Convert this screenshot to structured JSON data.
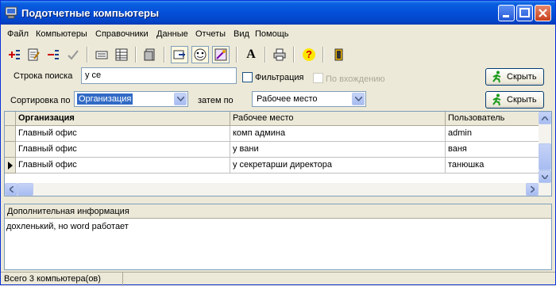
{
  "window": {
    "title": "Подотчетные компьютеры"
  },
  "menu": [
    "Файл",
    "Компьютеры",
    "Справочники",
    "Данные",
    "Отчеты",
    "Вид",
    "Помощь"
  ],
  "toolbar": {
    "icons": [
      "add-icon",
      "edit-icon",
      "delete-icon",
      "confirm-icon",
      "card-icon",
      "columns-icon",
      "print-preview-icon",
      "pin-icon",
      "face-icon",
      "magic-icon",
      "font-icon",
      "printer-icon",
      "help-icon",
      "exit-icon"
    ],
    "font_glyph": "A",
    "help_glyph": "?"
  },
  "search": {
    "label": "Строка поиска",
    "value": "у се",
    "filter_label": "Фильтрация",
    "filter_checked": false,
    "entry_label": "По вхождению",
    "entry_enabled": false,
    "hide_label": "Скрыть"
  },
  "sort": {
    "label": "Сортировка по",
    "primary": "Организация",
    "then_label": "затем по",
    "secondary": "Рабочее место",
    "hide_label": "Скрыть"
  },
  "grid": {
    "columns": [
      "Организация",
      "Рабочее место",
      "Пользователь"
    ],
    "rows": [
      [
        "Главный офис",
        "комп админа",
        "admin"
      ],
      [
        "Главный офис",
        "у вани",
        "ваня"
      ],
      [
        "Главный офис",
        "у секретарши директора",
        "танюшка"
      ]
    ],
    "current_row": 2
  },
  "info": {
    "title": "Дополнительная информация",
    "text": "дохленький, но word работает"
  },
  "status": {
    "text": "Всего 3 компьютера(ов)"
  }
}
